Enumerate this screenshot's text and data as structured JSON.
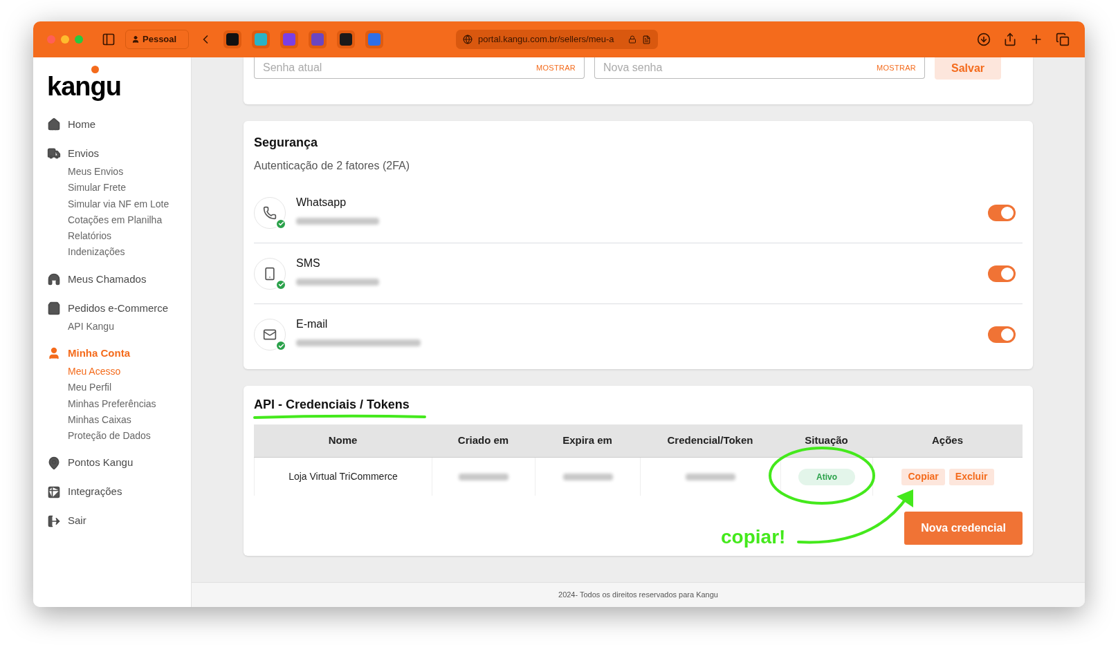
{
  "browser": {
    "profile": "Pessoal",
    "url": "portal.kangu.com.br/sellers/meu-a"
  },
  "sidebar": {
    "logo": "kangu",
    "items": [
      {
        "label": "Home",
        "selected": false
      },
      {
        "label": "Envios",
        "selected": false,
        "children": [
          {
            "label": "Meus Envios",
            "selected": false
          },
          {
            "label": "Simular Frete",
            "selected": false
          },
          {
            "label": "Simular via NF em Lote",
            "selected": false
          },
          {
            "label": "Cotações em Planilha",
            "selected": false
          },
          {
            "label": "Relatórios",
            "selected": false
          },
          {
            "label": "Indenizações",
            "selected": false
          }
        ]
      },
      {
        "label": "Meus Chamados",
        "selected": false
      },
      {
        "label": "Pedidos e-Commerce",
        "selected": false,
        "children": [
          {
            "label": "API Kangu",
            "selected": false
          }
        ]
      },
      {
        "label": "Minha Conta",
        "selected": true,
        "children": [
          {
            "label": "Meu Acesso",
            "selected": true
          },
          {
            "label": "Meu Perfil",
            "selected": false
          },
          {
            "label": "Minhas Preferências",
            "selected": false
          },
          {
            "label": "Minhas Caixas",
            "selected": false
          },
          {
            "label": "Proteção de Dados",
            "selected": false
          }
        ]
      },
      {
        "label": "Pontos Kangu",
        "selected": false
      },
      {
        "label": "Integrações",
        "selected": false
      },
      {
        "label": "Sair",
        "selected": false
      }
    ]
  },
  "password": {
    "fields": [
      {
        "placeholder": "Senha atual",
        "toggle": "MOSTRAR"
      },
      {
        "placeholder": "Nova senha",
        "toggle": "MOSTRAR"
      }
    ],
    "save": "Salvar"
  },
  "security": {
    "title": "Segurança",
    "subtitle": "Autenticação de 2 fatores (2FA)",
    "methods": [
      {
        "name": "Whatsapp",
        "verified": true,
        "on": true
      },
      {
        "name": "SMS",
        "verified": true,
        "on": true
      },
      {
        "name": "E-mail",
        "verified": true,
        "on": true
      }
    ]
  },
  "api": {
    "title": "API - Credenciais / Tokens",
    "columns": [
      "Nome",
      "Criado em",
      "Expira em",
      "Credencial/Token",
      "Situação",
      "Ações"
    ],
    "rows": [
      {
        "name": "Loja Virtual TriCommerce",
        "status": "Ativo",
        "actions": [
          "Copiar",
          "Excluir"
        ]
      }
    ],
    "new_button": "Nova credencial"
  },
  "annotation": {
    "note": "copiar!"
  },
  "footer": "2024- Todos os direitos reservados para Kangu"
}
